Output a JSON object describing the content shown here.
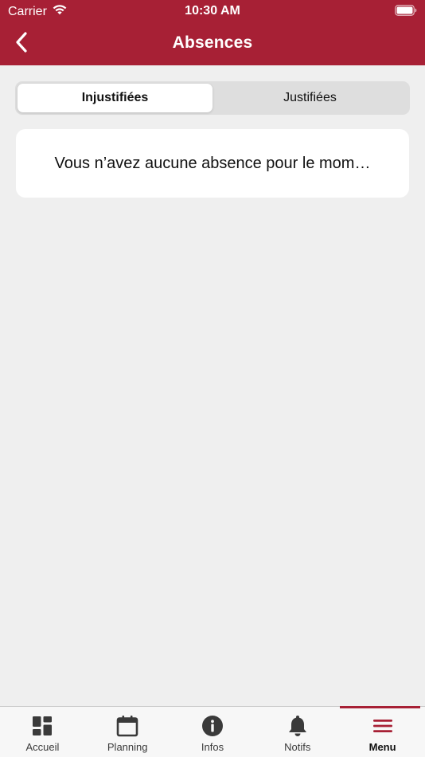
{
  "status_bar": {
    "carrier": "Carrier",
    "time": "10:30 AM"
  },
  "nav": {
    "title": "Absences",
    "back_icon": "chevron-left-icon"
  },
  "segments": {
    "items": [
      {
        "label": "Injustifiées",
        "selected": true
      },
      {
        "label": "Justifiées",
        "selected": false
      }
    ]
  },
  "empty_state": {
    "message": "Vous n’avez aucune absence pour le mom…"
  },
  "tab_bar": {
    "items": [
      {
        "label": "Accueil",
        "icon": "dashboard-icon",
        "selected": false
      },
      {
        "label": "Planning",
        "icon": "calendar-icon",
        "selected": false
      },
      {
        "label": "Infos",
        "icon": "info-icon",
        "selected": false
      },
      {
        "label": "Notifs",
        "icon": "bell-icon",
        "selected": false
      },
      {
        "label": "Menu",
        "icon": "menu-icon",
        "selected": true
      }
    ]
  },
  "colors": {
    "brand": "#a72035",
    "background": "#efefef",
    "segment_track": "#dedede"
  }
}
